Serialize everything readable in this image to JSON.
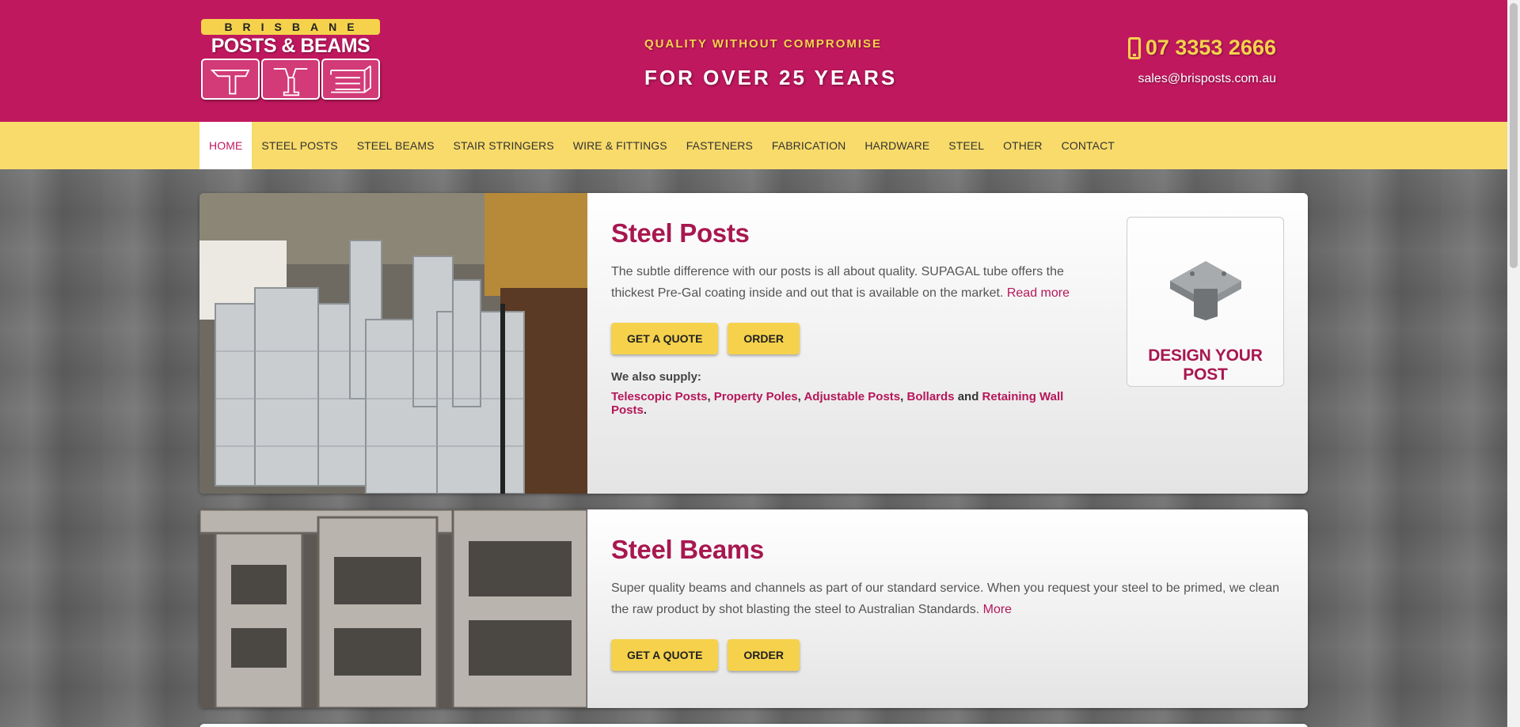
{
  "brand": {
    "top": "BRISBANE",
    "main": "POSTS & BEAMS"
  },
  "header": {
    "tagline_small": "QUALITY WITHOUT COMPROMISE",
    "tagline_big": "FOR OVER 25 YEARS",
    "phone": "07 3353 2666",
    "email": "sales@brisposts.com.au"
  },
  "nav": {
    "items": [
      "HOME",
      "STEEL POSTS",
      "STEEL BEAMS",
      "STAIR STRINGERS",
      "WIRE & FITTINGS",
      "FASTENERS",
      "FABRICATION",
      "HARDWARE",
      "STEEL",
      "OTHER",
      "CONTACT"
    ],
    "active": "HOME"
  },
  "cards": [
    {
      "title": "Steel Posts",
      "desc": "The subtle difference with our posts is all about quality. SUPAGAL tube offers the thickest Pre-Gal coating inside and out that is available on the market.",
      "more": "Read more",
      "quote_label": "GET A QUOTE",
      "order_label": "ORDER",
      "supply_label": "We also supply:",
      "supply": [
        "Telescopic Posts",
        "Property Poles",
        "Adjustable Posts",
        "Bollards",
        "Retaining Wall Posts"
      ],
      "sep_comma": ",",
      "sep_and": "and",
      "sep_end": ".",
      "design_label": "DESIGN YOUR POST"
    },
    {
      "title": "Steel Beams",
      "desc": "Super quality beams and channels as part of our standard service. When you request your steel to be primed, we clean the raw product by shot blasting the steel to Australian Standards.",
      "more": "More",
      "quote_label": "GET A QUOTE",
      "order_label": "ORDER"
    }
  ],
  "colors": {
    "brand": "#c0185f",
    "accent": "#f6d24c",
    "nav_bg": "#f8db6a"
  }
}
